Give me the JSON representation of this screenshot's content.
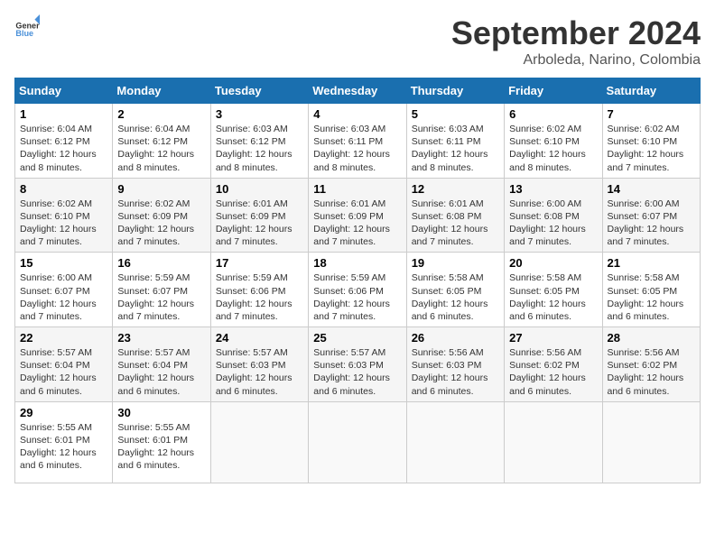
{
  "header": {
    "logo_general": "General",
    "logo_blue": "Blue",
    "month_title": "September 2024",
    "location": "Arboleda, Narino, Colombia"
  },
  "days_of_week": [
    "Sunday",
    "Monday",
    "Tuesday",
    "Wednesday",
    "Thursday",
    "Friday",
    "Saturday"
  ],
  "weeks": [
    [
      {
        "day": "1",
        "sunrise": "6:04 AM",
        "sunset": "6:12 PM",
        "daylight": "12 hours and 8 minutes."
      },
      {
        "day": "2",
        "sunrise": "6:04 AM",
        "sunset": "6:12 PM",
        "daylight": "12 hours and 8 minutes."
      },
      {
        "day": "3",
        "sunrise": "6:03 AM",
        "sunset": "6:12 PM",
        "daylight": "12 hours and 8 minutes."
      },
      {
        "day": "4",
        "sunrise": "6:03 AM",
        "sunset": "6:11 PM",
        "daylight": "12 hours and 8 minutes."
      },
      {
        "day": "5",
        "sunrise": "6:03 AM",
        "sunset": "6:11 PM",
        "daylight": "12 hours and 8 minutes."
      },
      {
        "day": "6",
        "sunrise": "6:02 AM",
        "sunset": "6:10 PM",
        "daylight": "12 hours and 8 minutes."
      },
      {
        "day": "7",
        "sunrise": "6:02 AM",
        "sunset": "6:10 PM",
        "daylight": "12 hours and 7 minutes."
      }
    ],
    [
      {
        "day": "8",
        "sunrise": "6:02 AM",
        "sunset": "6:10 PM",
        "daylight": "12 hours and 7 minutes."
      },
      {
        "day": "9",
        "sunrise": "6:02 AM",
        "sunset": "6:09 PM",
        "daylight": "12 hours and 7 minutes."
      },
      {
        "day": "10",
        "sunrise": "6:01 AM",
        "sunset": "6:09 PM",
        "daylight": "12 hours and 7 minutes."
      },
      {
        "day": "11",
        "sunrise": "6:01 AM",
        "sunset": "6:09 PM",
        "daylight": "12 hours and 7 minutes."
      },
      {
        "day": "12",
        "sunrise": "6:01 AM",
        "sunset": "6:08 PM",
        "daylight": "12 hours and 7 minutes."
      },
      {
        "day": "13",
        "sunrise": "6:00 AM",
        "sunset": "6:08 PM",
        "daylight": "12 hours and 7 minutes."
      },
      {
        "day": "14",
        "sunrise": "6:00 AM",
        "sunset": "6:07 PM",
        "daylight": "12 hours and 7 minutes."
      }
    ],
    [
      {
        "day": "15",
        "sunrise": "6:00 AM",
        "sunset": "6:07 PM",
        "daylight": "12 hours and 7 minutes."
      },
      {
        "day": "16",
        "sunrise": "5:59 AM",
        "sunset": "6:07 PM",
        "daylight": "12 hours and 7 minutes."
      },
      {
        "day": "17",
        "sunrise": "5:59 AM",
        "sunset": "6:06 PM",
        "daylight": "12 hours and 7 minutes."
      },
      {
        "day": "18",
        "sunrise": "5:59 AM",
        "sunset": "6:06 PM",
        "daylight": "12 hours and 7 minutes."
      },
      {
        "day": "19",
        "sunrise": "5:58 AM",
        "sunset": "6:05 PM",
        "daylight": "12 hours and 6 minutes."
      },
      {
        "day": "20",
        "sunrise": "5:58 AM",
        "sunset": "6:05 PM",
        "daylight": "12 hours and 6 minutes."
      },
      {
        "day": "21",
        "sunrise": "5:58 AM",
        "sunset": "6:05 PM",
        "daylight": "12 hours and 6 minutes."
      }
    ],
    [
      {
        "day": "22",
        "sunrise": "5:57 AM",
        "sunset": "6:04 PM",
        "daylight": "12 hours and 6 minutes."
      },
      {
        "day": "23",
        "sunrise": "5:57 AM",
        "sunset": "6:04 PM",
        "daylight": "12 hours and 6 minutes."
      },
      {
        "day": "24",
        "sunrise": "5:57 AM",
        "sunset": "6:03 PM",
        "daylight": "12 hours and 6 minutes."
      },
      {
        "day": "25",
        "sunrise": "5:57 AM",
        "sunset": "6:03 PM",
        "daylight": "12 hours and 6 minutes."
      },
      {
        "day": "26",
        "sunrise": "5:56 AM",
        "sunset": "6:03 PM",
        "daylight": "12 hours and 6 minutes."
      },
      {
        "day": "27",
        "sunrise": "5:56 AM",
        "sunset": "6:02 PM",
        "daylight": "12 hours and 6 minutes."
      },
      {
        "day": "28",
        "sunrise": "5:56 AM",
        "sunset": "6:02 PM",
        "daylight": "12 hours and 6 minutes."
      }
    ],
    [
      {
        "day": "29",
        "sunrise": "5:55 AM",
        "sunset": "6:01 PM",
        "daylight": "12 hours and 6 minutes."
      },
      {
        "day": "30",
        "sunrise": "5:55 AM",
        "sunset": "6:01 PM",
        "daylight": "12 hours and 6 minutes."
      },
      null,
      null,
      null,
      null,
      null
    ]
  ]
}
